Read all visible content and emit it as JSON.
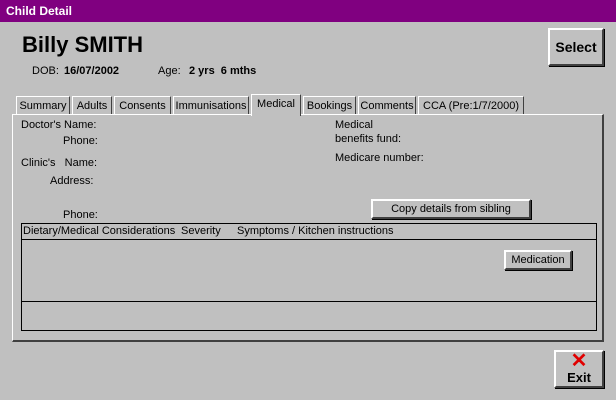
{
  "window": {
    "title": "Child Detail"
  },
  "child": {
    "name": "Billy SMITH",
    "dob_label": "DOB:",
    "dob": "16/07/2002",
    "age_label": "Age:",
    "age": "2 yrs  6 mths"
  },
  "header": {
    "select_label": "Select"
  },
  "tabs": [
    {
      "label": "Summary"
    },
    {
      "label": "Adults"
    },
    {
      "label": "Consents"
    },
    {
      "label": "Immunisations"
    },
    {
      "label": "Medical",
      "active": true
    },
    {
      "label": "Bookings"
    },
    {
      "label": "Comments"
    },
    {
      "label": "CCA (Pre:1/7/2000)"
    }
  ],
  "medical": {
    "doctors_name_label": "Doctor's Name:",
    "doctor_phone_label": "Phone:",
    "clinic_name_label": "Clinic's   Name:",
    "clinic_address_label": "Address:",
    "clinic_phone_label": "Phone:",
    "benefits_fund_label_1": "Medical",
    "benefits_fund_label_2": "benefits fund:",
    "medicare_label": "Medicare number:",
    "copy_button_label": "Copy details from sibling",
    "grid_headers": [
      "Dietary/Medical Considerations",
      "Severity",
      "Symptoms / Kitchen instructions"
    ],
    "medication_button_label": "Medication"
  },
  "footer": {
    "exit_label": "Exit"
  },
  "colors": {
    "titlebar": "#800080",
    "exit_icon": "#e00000"
  },
  "icons": {
    "exit": "close-icon"
  }
}
